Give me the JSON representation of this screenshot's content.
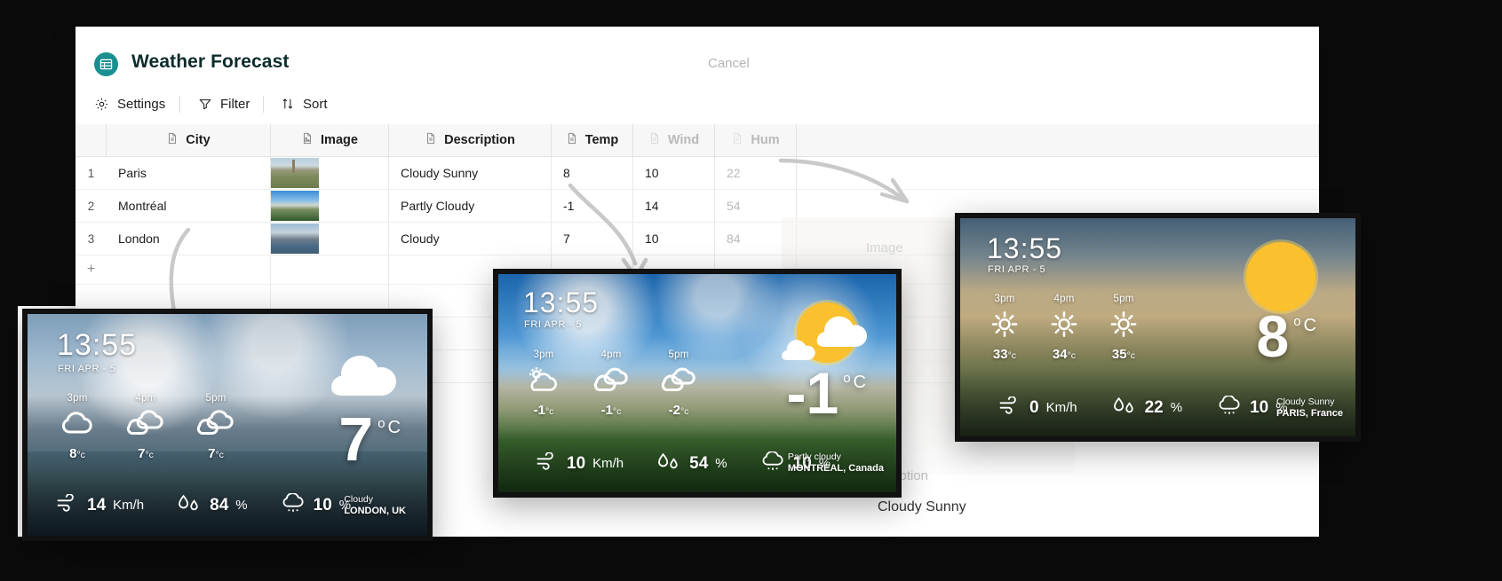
{
  "window": {
    "app_title": "Weather Forecast",
    "cancel_label": "Cancel",
    "logo_icon": "table-grid-icon",
    "accent_color": "#1a8f91"
  },
  "toolbar": {
    "items": [
      {
        "label": "Settings",
        "icon": "gear-icon"
      },
      {
        "label": "Filter",
        "icon": "funnel-icon"
      },
      {
        "label": "Sort",
        "icon": "sort-arrows-icon"
      }
    ]
  },
  "table": {
    "columns": [
      {
        "label": "City",
        "icon": "text-file-icon",
        "muted": false
      },
      {
        "label": "Image",
        "icon": "image-file-icon",
        "muted": false
      },
      {
        "label": "Description",
        "icon": "text-file-icon",
        "muted": false
      },
      {
        "label": "Temp",
        "icon": "text-file-icon",
        "muted": false
      },
      {
        "label": "Wind",
        "icon": "text-file-icon",
        "muted": true
      },
      {
        "label": "Hum",
        "icon": "text-file-icon",
        "muted": true
      }
    ],
    "rows": [
      {
        "index": "1",
        "city": "Paris",
        "description": "Cloudy Sunny",
        "temp": "8",
        "wind": "10",
        "hum": "22"
      },
      {
        "index": "2",
        "city": "Montréal",
        "description": "Partly Cloudy",
        "temp": "-1",
        "wind": "14",
        "hum": "54"
      },
      {
        "index": "3",
        "city": "London",
        "description": "Cloudy",
        "temp": "7",
        "wind": "10",
        "hum": "84"
      }
    ],
    "add_row_label": "+"
  },
  "detail_panel": {
    "description_label": "Description",
    "description_value": "Cloudy Sunny",
    "image_label": "Image"
  },
  "cards": [
    {
      "id": "london",
      "time": "13:55",
      "date": "FRI APR - 5",
      "hours": [
        {
          "label": "3pm",
          "icon": "cloud-icon",
          "temp": "8",
          "unit": "°c"
        },
        {
          "label": "4pm",
          "icon": "clouds-icon",
          "temp": "7",
          "unit": "°c"
        },
        {
          "label": "5pm",
          "icon": "clouds-icon",
          "temp": "7",
          "unit": "°c"
        }
      ],
      "big_temp": "7",
      "big_unit_o": "o",
      "big_unit_c": "C",
      "big_icon": "cloud-icon",
      "stats": [
        {
          "icon": "wind-icon",
          "value": "14",
          "unit": "Km/h"
        },
        {
          "icon": "humidity-icon",
          "value": "84",
          "unit": "%"
        },
        {
          "icon": "rain-icon",
          "value": "10",
          "unit": "%"
        }
      ],
      "condition": "Cloudy",
      "location": "LONDON, UK"
    },
    {
      "id": "montreal",
      "time": "13:55",
      "date": "FRI APR - 5",
      "hours": [
        {
          "label": "3pm",
          "icon": "sun-behind-cloud-icon",
          "temp": "-1",
          "unit": "°c"
        },
        {
          "label": "4pm",
          "icon": "clouds-icon",
          "temp": "-1",
          "unit": "°c"
        },
        {
          "label": "5pm",
          "icon": "clouds-icon",
          "temp": "-2",
          "unit": "°c"
        }
      ],
      "big_temp": "-1",
      "big_unit_o": "o",
      "big_unit_c": "C",
      "big_icon": "sun-behind-cloud-icon",
      "stats": [
        {
          "icon": "wind-icon",
          "value": "10",
          "unit": "Km/h"
        },
        {
          "icon": "humidity-icon",
          "value": "54",
          "unit": "%"
        },
        {
          "icon": "rain-icon",
          "value": "10",
          "unit": "%"
        }
      ],
      "condition": "Partly cloudy",
      "location": "MONTREAL, Canada"
    },
    {
      "id": "paris",
      "time": "13:55",
      "date": "FRI APR - 5",
      "hours": [
        {
          "label": "3pm",
          "icon": "sun-icon",
          "temp": "33",
          "unit": "°c"
        },
        {
          "label": "4pm",
          "icon": "sun-icon",
          "temp": "34",
          "unit": "°c"
        },
        {
          "label": "5pm",
          "icon": "sun-icon",
          "temp": "35",
          "unit": "°c"
        }
      ],
      "big_temp": "8",
      "big_unit_o": "o",
      "big_unit_c": "C",
      "big_icon": "sun-icon",
      "stats": [
        {
          "icon": "wind-icon",
          "value": "0",
          "unit": "Km/h"
        },
        {
          "icon": "humidity-icon",
          "value": "22",
          "unit": "%"
        },
        {
          "icon": "rain-icon",
          "value": "10",
          "unit": "%"
        }
      ],
      "condition": "Cloudy Sunny",
      "location": "PARIS, France"
    }
  ]
}
